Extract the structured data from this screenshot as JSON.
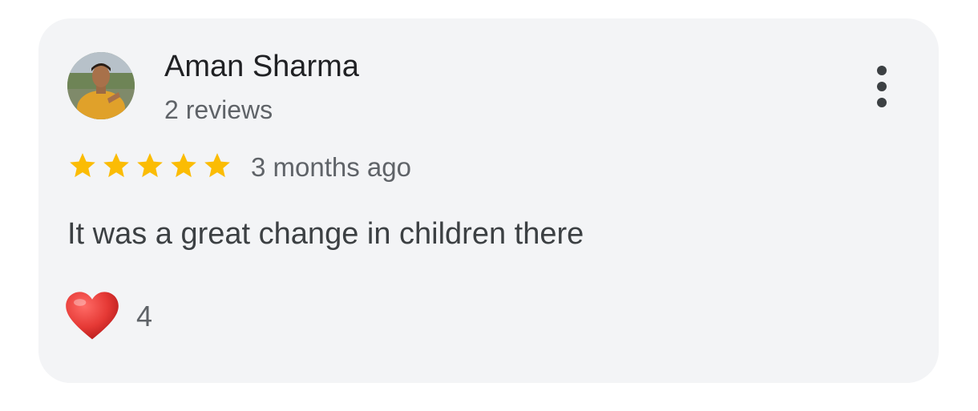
{
  "review": {
    "author_name": "Aman Sharma",
    "author_reviews": "2 reviews",
    "rating": 5,
    "rating_max": 5,
    "time_ago": "3 months ago",
    "text": "It was a great change in children there",
    "reaction_count": "4"
  },
  "icons": {
    "avatar": "profile-photo",
    "menu": "more-vert-icon",
    "star": "star-icon",
    "reaction": "heart-icon"
  },
  "colors": {
    "card_background": "#f3f4f6",
    "star": "#fbbc04",
    "heart": "#e53935",
    "primary_text": "#202124",
    "secondary_text": "#5f6368"
  }
}
